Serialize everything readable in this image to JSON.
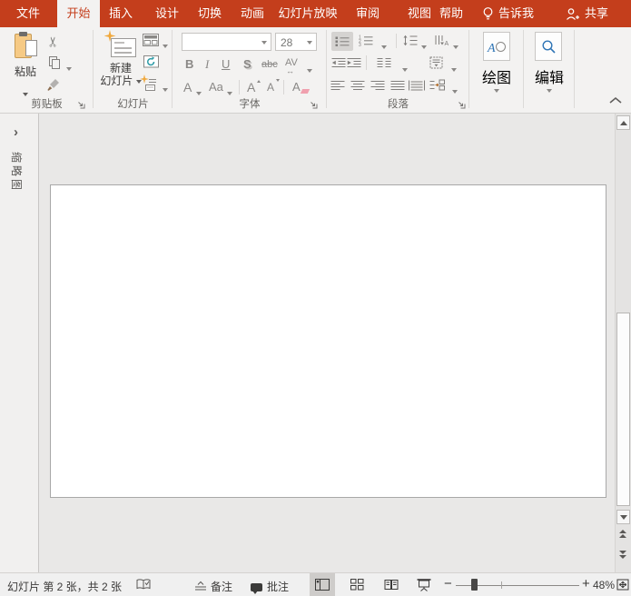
{
  "colors": {
    "accent": "#C43E1C",
    "ribbon_bg": "#F3F2F1",
    "canvas_bg": "#E9E8E7",
    "sparkle": "#F0A83C"
  },
  "tab_bar": {
    "items": [
      "文件",
      "开始",
      "插入",
      "设计",
      "切换",
      "动画",
      "幻灯片放映",
      "审阅",
      "视图",
      "帮助"
    ],
    "active": "开始",
    "tell_me": "告诉我",
    "share": "共享"
  },
  "ribbon": {
    "clipboard": {
      "group": "剪贴板",
      "paste": "粘贴"
    },
    "slides": {
      "group": "幻灯片",
      "new_slide_1": "新建",
      "new_slide_2": "幻灯片"
    },
    "font": {
      "group": "字体",
      "font_name": "",
      "font_size": "28",
      "bold": "B",
      "italic": "I",
      "underline": "U",
      "shadow": "S",
      "strikethrough": "abc",
      "char_spacing": "AV",
      "spacing_arrow": "↔",
      "font_color": "A",
      "change_case": "Aa",
      "grow_font": "A",
      "shrink_font": "A",
      "clear_format": "A"
    },
    "paragraph": {
      "group": "段落"
    },
    "drawing": {
      "group": "绘图"
    },
    "editing": {
      "group": "编辑"
    }
  },
  "icons": {
    "scissors": "✂",
    "expand_chevron": "›",
    "zoom_out": "−",
    "zoom_in": "+"
  },
  "left_pane": {
    "label": "缩略图"
  },
  "status_bar": {
    "slide_counter": "幻灯片 第 2 张，共 2 张",
    "notes": "备注",
    "comments": "批注",
    "zoom_level": "48%"
  }
}
